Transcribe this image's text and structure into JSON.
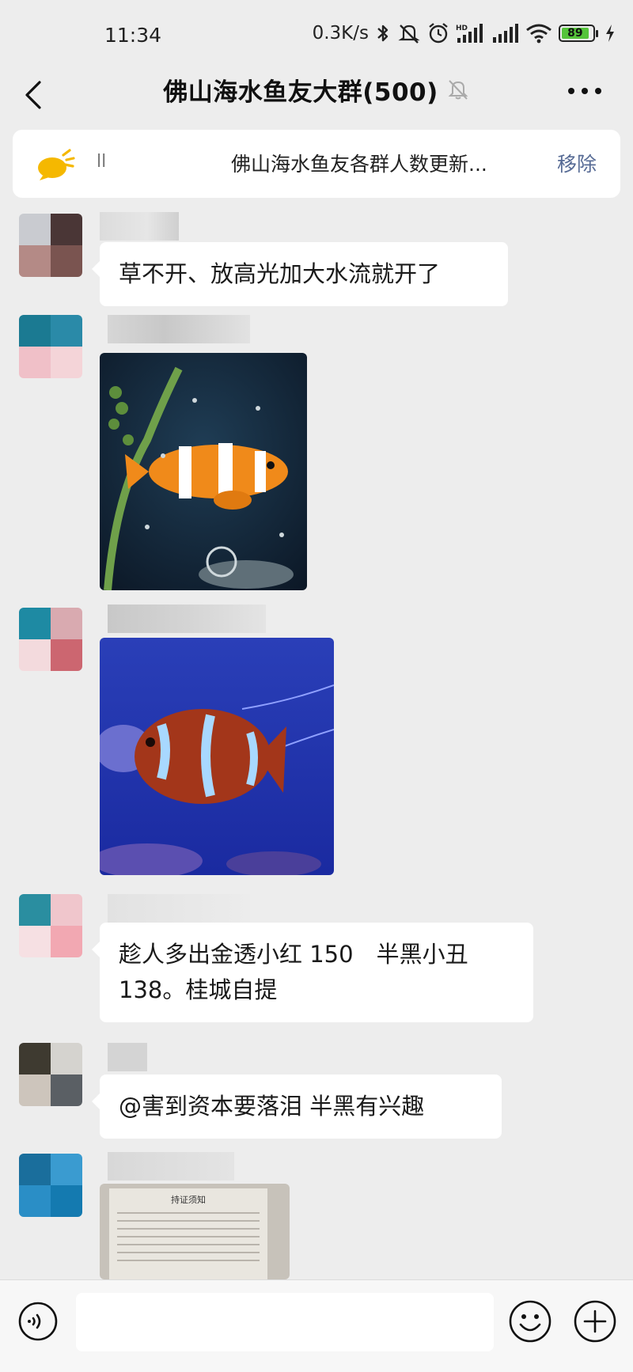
{
  "status": {
    "time": "11:34",
    "speed": "0.3K/s",
    "battery": "89"
  },
  "header": {
    "title": "佛山海水鱼友大群(500)"
  },
  "notice": {
    "prefix": "ll",
    "text": "佛山海水鱼友各群人数更新...",
    "remove_label": "移除"
  },
  "messages": [
    {
      "type": "text",
      "text": "草不开、放高光加大水流就开了"
    },
    {
      "type": "image",
      "description": "clownfish-photo"
    },
    {
      "type": "image",
      "description": "maroon-clownfish-photo"
    },
    {
      "type": "text",
      "text": "趁人多出金透小红 150　半黑小丑 138。桂城自提"
    },
    {
      "type": "text",
      "text": "@害到资本要落泪  半黑有兴趣"
    },
    {
      "type": "image",
      "description": "document-photo"
    }
  ],
  "doc_photo": {
    "title": "持证须知"
  },
  "input": {
    "placeholder": ""
  },
  "colors": {
    "background": "#ededed",
    "link": "#576b95",
    "bubble": "#ffffff"
  }
}
